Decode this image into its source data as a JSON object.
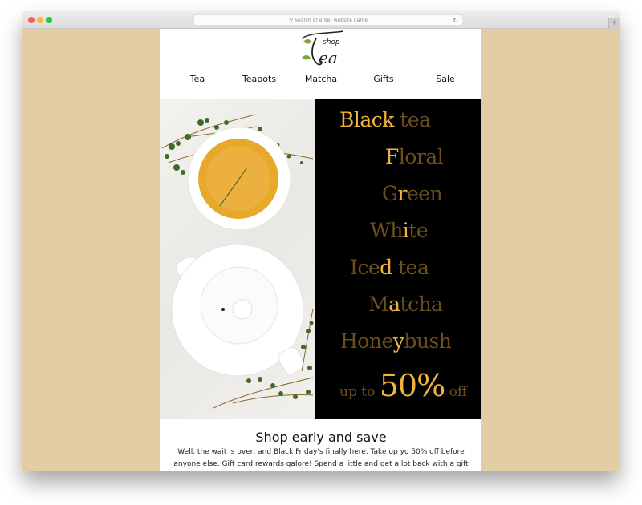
{
  "browser": {
    "url_placeholder": "Search or enter website name",
    "traffic_lights": {
      "close": "#f1615a",
      "minimize": "#f7bd2f",
      "maximize": "#28c840"
    },
    "new_tab_label": "+"
  },
  "site": {
    "logo": {
      "small": "shop",
      "large": "Tea"
    },
    "nav": [
      {
        "label": "Tea"
      },
      {
        "label": "Teapots"
      },
      {
        "label": "Matcha"
      },
      {
        "label": "Gifts"
      },
      {
        "label": "Sale"
      }
    ]
  },
  "hero": {
    "image_alt": "White teacup of golden tea and white teapot with thyme sprigs on white wooden table",
    "lines": [
      {
        "pre": "",
        "hl": "Black",
        "post": " tea"
      },
      {
        "pre": "",
        "hl": "F",
        "post": "loral"
      },
      {
        "pre": "G",
        "hl": "r",
        "post": "een"
      },
      {
        "pre": "Wh",
        "hl": "i",
        "post": "te"
      },
      {
        "pre": "Ice",
        "hl": "d",
        "post": " tea"
      },
      {
        "pre": "M",
        "hl": "a",
        "post": "tcha"
      },
      {
        "pre": "Hone",
        "hl": "y",
        "post": "bush"
      }
    ],
    "discount": {
      "prefix": "up to ",
      "value": "50%",
      "suffix": " off"
    },
    "colors": {
      "highlight": "#f2b33a",
      "muted": "#6b4f1c",
      "background": "#000000"
    }
  },
  "content": {
    "headline": "Shop early and save",
    "body": "Well, the wait is over, and Black Friday's finally here. Take up yo 50% off before anyone else. Gift card rewards galore! Spend a little and get a lot back with a gift card you can"
  },
  "theme": {
    "backdrop": "#e3cda5"
  }
}
